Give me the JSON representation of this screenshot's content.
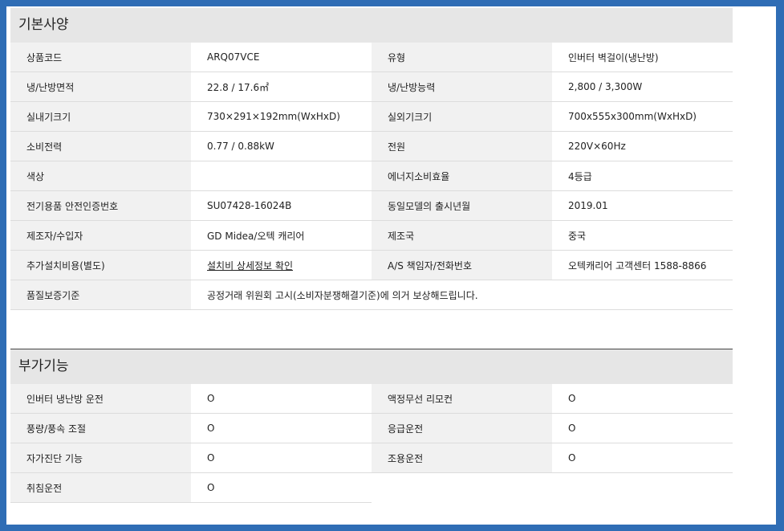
{
  "basic": {
    "title": "기본사양",
    "rows": [
      {
        "k1": "상품코드",
        "v1": "ARQ07VCE",
        "k2": "유형",
        "v2": "인버터 벽걸이(냉난방)"
      },
      {
        "k1": "냉/난방면적",
        "v1": "22.8 / 17.6㎡",
        "k2": "냉/난방능력",
        "v2": "2,800 / 3,300W"
      },
      {
        "k1": "실내기크기",
        "v1": "730×291×192mm(WxHxD)",
        "k2": "실외기크기",
        "v2": "700x555x300mm(WxHxD)"
      },
      {
        "k1": "소비전력",
        "v1": "0.77 / 0.88kW",
        "k2": "전원",
        "v2": "220V×60Hz"
      },
      {
        "k1": "색상",
        "v1": "",
        "k2": "에너지소비효율",
        "v2": "4등급"
      },
      {
        "k1": "전기용품 안전인증번호",
        "v1": "SU07428-16024B",
        "k2": "동일모델의 출시년월",
        "v2": "2019.01"
      },
      {
        "k1": "제조자/수입자",
        "v1": "GD Midea/오텍 캐리어",
        "k2": "제조국",
        "v2": "중국"
      },
      {
        "k1": "추가설치비용(별도)",
        "v1": "설치비 상세정보 확인",
        "k2": "A/S 책임자/전화번호",
        "v2": "오텍캐리어 고객센터 1588-8866"
      }
    ],
    "warranty": {
      "k": "품질보증기준",
      "v": "공정거래 위원회 고시(소비자분쟁해결기준)에 의거 보상해드립니다."
    }
  },
  "extra": {
    "title": "부가기능",
    "rows": [
      {
        "k1": "인버터 냉난방 운전",
        "v1": "O",
        "k2": "액정무선 리모컨",
        "v2": "O"
      },
      {
        "k1": "풍량/풍속 조절",
        "v1": "O",
        "k2": "응급운전",
        "v2": "O"
      },
      {
        "k1": "자가진단 기능",
        "v1": "O",
        "k2": "조용운전",
        "v2": "O"
      },
      {
        "k1": "취침운전",
        "v1": "O"
      }
    ]
  }
}
